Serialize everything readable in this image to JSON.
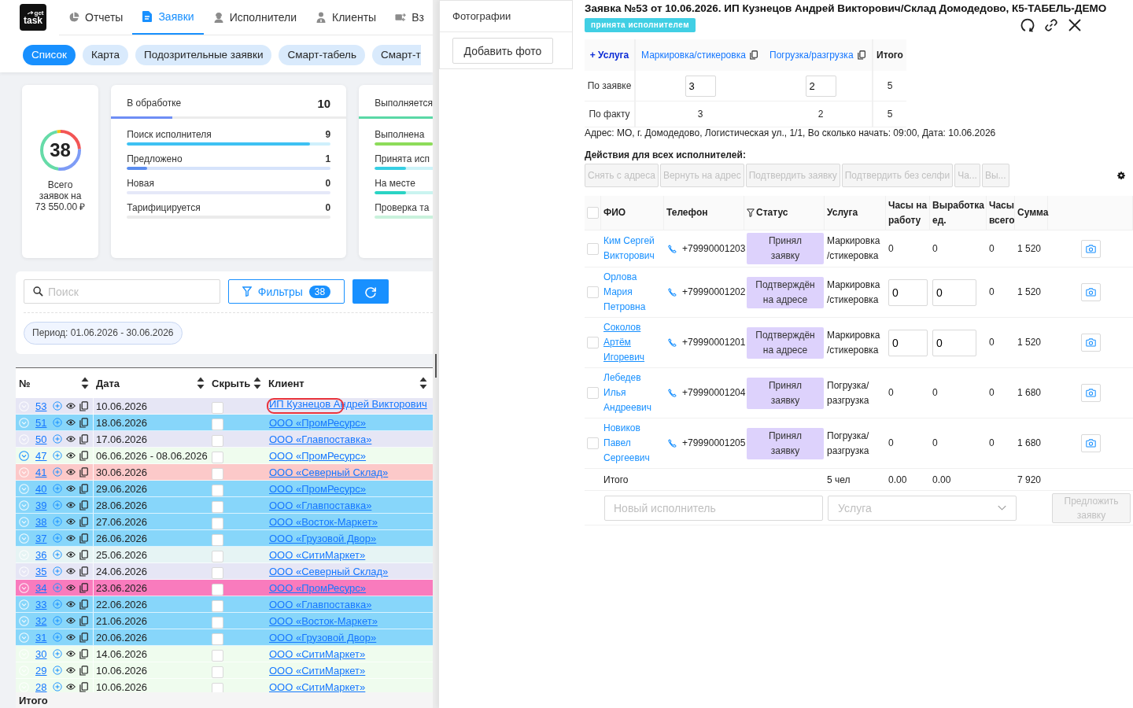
{
  "header": {
    "logo": {
      "top": "get",
      "bottom": "task"
    },
    "nav": [
      {
        "label": "Отчеты",
        "selected": false
      },
      {
        "label": "Заявки",
        "selected": true
      },
      {
        "label": "Исполнители",
        "selected": false
      },
      {
        "label": "Клиенты",
        "selected": false
      },
      {
        "label": "Вз",
        "selected": false
      }
    ],
    "views": [
      {
        "label": "Список",
        "selected": true
      },
      {
        "label": "Карта",
        "selected": false
      },
      {
        "label": "Подозрительные заявки",
        "selected": false
      },
      {
        "label": "Смарт-табель",
        "selected": false
      },
      {
        "label": "Смарт-т",
        "selected": false
      }
    ]
  },
  "summary": {
    "total": "38",
    "label": "Всего заявок на",
    "amount": "73 550.00 ₽"
  },
  "status_groups": [
    {
      "title": "В обработке",
      "count": "10",
      "color": "#6e8ef5",
      "level": 0.26,
      "items": [
        {
          "label": "Поиск исполнителя",
          "count": "9",
          "color": "#3ec1f3",
          "level": 0.9
        },
        {
          "label": "Предложено",
          "count": "1",
          "color": "#5b8def",
          "level": 0.1
        },
        {
          "label": "Новая",
          "count": "0",
          "color": "#e5e8f8"
        },
        {
          "label": "Тарифицируется",
          "count": "0",
          "color": "#ebebeb"
        }
      ]
    },
    {
      "title": "Выполняется",
      "color": "#5ad8a6",
      "level": 1,
      "items": [
        {
          "label": "Выполнена",
          "color": "#8ddc5a",
          "level": 1
        },
        {
          "label": "Принята исп",
          "color": "#36cfe3",
          "level": 0.54
        },
        {
          "label": "На месте",
          "color": "#2ad4c4",
          "level": 0.54
        },
        {
          "label": "Проверка та",
          "color": "#c9f2dc"
        }
      ]
    }
  ],
  "search": {
    "placeholder": "Поиск"
  },
  "filters": {
    "label": "Фильтры",
    "count": "38"
  },
  "period": "Период: 01.06.2026 - 30.06.2026",
  "orders_table": {
    "columns": [
      {
        "label": "№",
        "sortable": true
      },
      {
        "label": "Дата",
        "sortable": true
      },
      {
        "label": "Скрыть",
        "sortable": true
      },
      {
        "label": "Клиент",
        "sortable": true
      }
    ],
    "rows": [
      {
        "number": "53",
        "date": "10.06.2026",
        "client": "ИП Кузнецов Андрей Викторович",
        "color": "#e6e6f5",
        "expandable": false,
        "hidden": false,
        "highlighted": true
      },
      {
        "number": "51",
        "date": "18.06.2026",
        "client": "ООО «ПромРесурс»",
        "color": "#87d6fa",
        "expandable": false,
        "hidden": false,
        "highlighted": false
      },
      {
        "number": "50",
        "date": "17.06.2026",
        "client": "ООО «Главпоставка»",
        "color": "#e6e6f5",
        "expandable": false,
        "hidden": false,
        "highlighted": false
      },
      {
        "number": "47",
        "date": "06.06.2026 - 08.06.2026",
        "client": "ООО «ПромРесурс»",
        "color": "#effcee",
        "expandable": true,
        "hidden": false,
        "highlighted": false
      },
      {
        "number": "41",
        "date": "30.06.2026",
        "client": "ООО «Северный Склад»",
        "color": "#fcc9c9",
        "expandable": false,
        "hidden": false,
        "highlighted": false
      },
      {
        "number": "40",
        "date": "29.06.2026",
        "client": "ООО «ПромРесурс»",
        "color": "#87d6fa",
        "expandable": false,
        "hidden": false,
        "highlighted": false
      },
      {
        "number": "39",
        "date": "28.06.2026",
        "client": "ООО «Главпоставка»",
        "color": "#87d6fa",
        "expandable": false,
        "hidden": false,
        "highlighted": false
      },
      {
        "number": "38",
        "date": "27.06.2026",
        "client": "ООО «Восток-Маркет»",
        "color": "#87d6fa",
        "expandable": false,
        "hidden": false,
        "highlighted": false
      },
      {
        "number": "37",
        "date": "26.06.2026",
        "client": "ООО «Грузовой Двор»",
        "color": "#87d6fa",
        "expandable": false,
        "hidden": false,
        "highlighted": false
      },
      {
        "number": "36",
        "date": "25.06.2026",
        "client": "ООО «СитиМаркет»",
        "color": "#e6f4f4",
        "expandable": false,
        "hidden": false,
        "highlighted": false
      },
      {
        "number": "35",
        "date": "24.06.2026",
        "client": "ООО «Северный Склад»",
        "color": "#e6e6f5",
        "expandable": false,
        "hidden": false,
        "highlighted": false
      },
      {
        "number": "34",
        "date": "23.06.2026",
        "client": "ООО «ПромРесурс»",
        "color": "#f97bbd",
        "expandable": false,
        "hidden": false,
        "highlighted": false
      },
      {
        "number": "33",
        "date": "22.06.2026",
        "client": "ООО «Главпоставка»",
        "color": "#87d6fa",
        "expandable": false,
        "hidden": false,
        "highlighted": false
      },
      {
        "number": "32",
        "date": "21.06.2026",
        "client": "ООО «Восток-Маркет»",
        "color": "#87d6fa",
        "expandable": false,
        "hidden": false,
        "highlighted": false
      },
      {
        "number": "31",
        "date": "20.06.2026",
        "client": "ООО «Грузовой Двор»",
        "color": "#87d6fa",
        "expandable": false,
        "hidden": false,
        "highlighted": false
      },
      {
        "number": "30",
        "date": "14.06.2026",
        "client": "ООО «СитиМаркет»",
        "color": "#effcee",
        "expandable": false,
        "hidden": false,
        "highlighted": false
      },
      {
        "number": "29",
        "date": "10.06.2026",
        "client": "ООО «СитиМаркет»",
        "color": "#effcee",
        "expandable": false,
        "hidden": false,
        "highlighted": false
      },
      {
        "number": "28",
        "date": "10.06.2026",
        "client": "ООО «СитиМаркет»",
        "color": "#effcee",
        "expandable": false,
        "hidden": false,
        "highlighted": false
      }
    ],
    "footer": "Итого"
  },
  "photos": {
    "title": "Фотографии",
    "button": "Добавить фото"
  },
  "order": {
    "title": "Заявка №53 от 10.06.2026. ИП Кузнецов Андрей Викторович/Склад Домодедово, К5-ТАБЕЛЬ-ДЕМО",
    "status": "принята исполнителем"
  },
  "services": {
    "add": "+ Услуга",
    "columns": [
      {
        "label": "Маркировка/стикеровка"
      },
      {
        "label": "Погрузка/разгрузка"
      }
    ],
    "total_label": "Итого",
    "rows": [
      {
        "label": "По заявке",
        "kind": "input",
        "values": [
          "3",
          "2"
        ],
        "total": "5"
      },
      {
        "label": "По факту",
        "kind": "text",
        "values": [
          "3",
          "2"
        ],
        "total": "5"
      }
    ]
  },
  "address": "Адрес: МО, г. Домодедово, Логистическая ул., 1/1, Во сколько начать: 09:00, Дата: 10.06.2026",
  "bulk_actions": {
    "label": "Действия для всех исполнителей:",
    "buttons": [
      {
        "label": "Снять с адреса",
        "disabled": true
      },
      {
        "label": "Вернуть на адрес",
        "disabled": true
      },
      {
        "label": "Подтвердить заявку",
        "disabled": true
      },
      {
        "label": "Подтвердить без селфи",
        "disabled": true
      },
      {
        "label": "Ча...",
        "disabled": true
      },
      {
        "label": "Вы...",
        "disabled": true
      }
    ]
  },
  "workers": {
    "all_checked": false,
    "columns": [
      {
        "label": "ФИО",
        "filter": false
      },
      {
        "label": "Телефон",
        "filter": false
      },
      {
        "label": "Статус",
        "filter": true
      },
      {
        "label": "Услуга",
        "filter": false
      },
      {
        "label": "Часы на работу",
        "filter": false
      },
      {
        "label": "Выработка ед.",
        "filter": false
      },
      {
        "label": "Часы всего",
        "filter": false
      },
      {
        "label": "Сумма",
        "filter": false
      }
    ],
    "rows": [
      {
        "name": "Ким Сергей Викторович",
        "hovered": false,
        "checked": false,
        "phone": "+79990001203",
        "status": "Принял заявку",
        "service": "Маркировка/стикеровка",
        "kind": "static",
        "hours": "0",
        "output": "0",
        "hours_total": "0",
        "sum": "1 520"
      },
      {
        "name": "Орлова Мария Петровна",
        "hovered": false,
        "checked": false,
        "phone": "+79990001202",
        "status": "Подтверждён на адресе",
        "service": "Маркировка/стикеровка",
        "kind": "editable",
        "hours": "0",
        "output": "0",
        "hours_total": "0",
        "sum": "1 520"
      },
      {
        "name": "Соколов Артём Игоревич",
        "hovered": true,
        "checked": false,
        "phone": "+79990001201",
        "status": "Подтверждён на адресе",
        "service": "Маркировка/стикеровка",
        "kind": "editable",
        "hours": "0",
        "output": "0",
        "hours_total": "0",
        "sum": "1 520"
      },
      {
        "name": "Лебедев Илья Андреевич",
        "hovered": false,
        "checked": false,
        "phone": "+79990001204",
        "status": "Принял заявку",
        "service": "Погрузка/разгрузка",
        "kind": "static",
        "hours": "0",
        "output": "0",
        "hours_total": "0",
        "sum": "1 680"
      },
      {
        "name": "Новиков Павел Сергеевич",
        "hovered": false,
        "checked": false,
        "phone": "+79990001205",
        "status": "Принял заявку",
        "service": "Погрузка/разгрузка",
        "kind": "static",
        "hours": "0",
        "output": "0",
        "hours_total": "0",
        "sum": "1 680"
      }
    ],
    "totals": {
      "label": "Итого",
      "people": "5 чел",
      "hours": "0.00",
      "output": "0.00",
      "sum": "7 920"
    },
    "new_worker": {
      "placeholder": "Новый исполнитель"
    },
    "service_select": {
      "placeholder": "Услуга"
    },
    "offer_button": {
      "label": "Предложить заявку",
      "disabled": true
    }
  }
}
